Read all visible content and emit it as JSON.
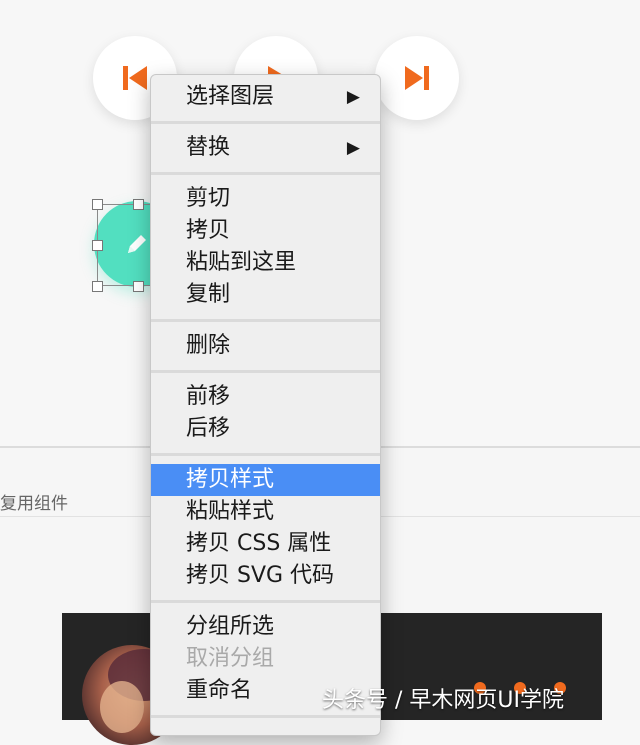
{
  "menu": {
    "items": [
      {
        "label": "选择图层",
        "submenu": true
      },
      {
        "label": "替换",
        "submenu": true
      },
      {
        "label": "剪切"
      },
      {
        "label": "拷贝"
      },
      {
        "label": "粘贴到这里"
      },
      {
        "label": "复制"
      },
      {
        "label": "删除"
      },
      {
        "label": "前移"
      },
      {
        "label": "后移"
      },
      {
        "label": "拷贝样式",
        "highlighted": true
      },
      {
        "label": "粘贴样式"
      },
      {
        "label": "拷贝 CSS 属性"
      },
      {
        "label": "拷贝 SVG 代码"
      },
      {
        "label": "分组所选"
      },
      {
        "label": "取消分组",
        "disabled": true
      },
      {
        "label": "重命名"
      }
    ],
    "submenu_glyph": "▶"
  },
  "panel": {
    "reuse_label": "复用组件"
  },
  "icons": {
    "prev": "skip-previous-icon",
    "play": "play-icon",
    "next": "skip-next-icon",
    "edit": "pencil-icon"
  },
  "colors": {
    "accent_orange": "#f06a1e",
    "teal": "#52dfc0",
    "menu_highlight": "#4a8ef5"
  },
  "watermark": "头条号 / 早木网页UI学院"
}
